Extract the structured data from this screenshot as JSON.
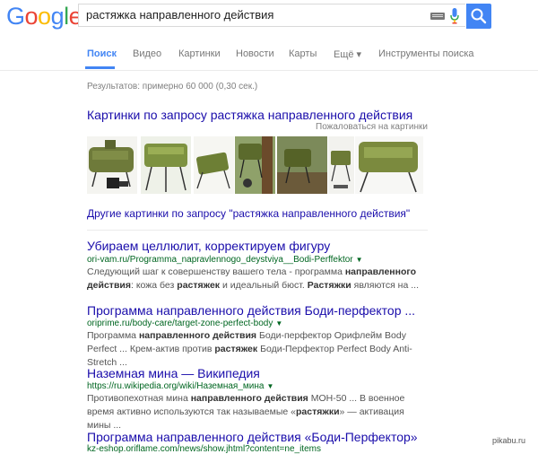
{
  "logo": {
    "letters": [
      "G",
      "o",
      "o",
      "g",
      "l",
      "e"
    ],
    "colors": [
      "#4285f4",
      "#ea4335",
      "#fbbc05",
      "#4285f4",
      "#34a853",
      "#ea4335"
    ]
  },
  "search": {
    "value": "растяжка направленного действия"
  },
  "tabs": [
    {
      "label": "Поиск",
      "active": true
    },
    {
      "label": "Видео"
    },
    {
      "label": "Картинки"
    },
    {
      "label": "Новости"
    },
    {
      "label": "Карты"
    },
    {
      "label": "Ещё ▾"
    },
    {
      "label": "Инструменты поиска"
    }
  ],
  "stats": "Результатов: примерно 60 000 (0,30 сек.)",
  "images_block": {
    "title": "Картинки по запросу растяжка направленного действия",
    "report": "Пожаловаться на картинки",
    "more": "Другие картинки по запросу \"растяжка направленного действия\""
  },
  "results": [
    {
      "title": "Убираем целлюлит, корректируем фигуру",
      "url": "ori-vam.ru/Programma_napravlennogo_deystviya__Bodi-Perffektor",
      "snippet": [
        "Следующий шаг к совершенству вашего тела - программа ",
        "направленного действия",
        ": кожа без ",
        "растяжек",
        " и идеальный бюст. ",
        "Растяжки",
        " являются на ..."
      ]
    },
    {
      "title": "Программа направленного действия Боди-перфектор ...",
      "url": "oriprime.ru/body-care/target-zone-perfect-body",
      "snippet": [
        "Программа ",
        "направленного действия",
        " Боди-перфектор Орифлейм Body Perfect ... Крем-актив против ",
        "растяжек",
        " Боди-Перфектор Perfect Body Anti-Stretch ..."
      ]
    },
    {
      "title": "Наземная мина — Википедия",
      "url": "https://ru.wikipedia.org/wiki/Наземная_мина",
      "snippet": [
        "Противопехотная мина ",
        "направленного действия",
        " МОН-50 ... В военное время активно используются так называемые «",
        "растяжки",
        "» — активация мины ..."
      ]
    },
    {
      "title": "Программа направленного действия «Боди-Перфектор»",
      "url": "kz-eshop.oriflame.com/news/show.jhtml?content=ne_items"
    }
  ],
  "watermark": "pikabu.ru"
}
